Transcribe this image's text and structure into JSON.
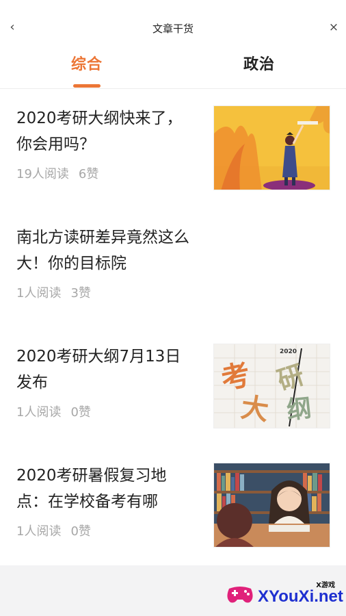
{
  "header": {
    "title": "文章干货",
    "back_icon": "chevron-left-icon",
    "close_icon": "close-icon"
  },
  "tabs": [
    {
      "label": "综合",
      "active": true
    },
    {
      "label": "政治",
      "active": false
    }
  ],
  "articles": [
    {
      "title": "2020考研大纲快来了，你会用吗？",
      "reads": "19人阅读",
      "likes": "6赞",
      "has_thumb": true
    },
    {
      "title": "南北方读研差异竟然这么大！你的目标院",
      "reads": "1人阅读",
      "likes": "3赞",
      "has_thumb": false
    },
    {
      "title": "2020考研大纲7月13日发布",
      "reads": "1人阅读",
      "likes": "0赞",
      "has_thumb": true
    },
    {
      "title": "2020考研暑假复习地点：在学校备考有哪",
      "reads": "1人阅读",
      "likes": "0赞",
      "has_thumb": true
    }
  ],
  "thumbs": {
    "graduate": [
      "考",
      "研",
      "大",
      "纲",
      "2020"
    ]
  },
  "watermark": {
    "text": "XYouXi.net",
    "sub": "X游戏"
  },
  "colors": {
    "accent": "#ec7636",
    "watermark": "#1e2fd0"
  }
}
